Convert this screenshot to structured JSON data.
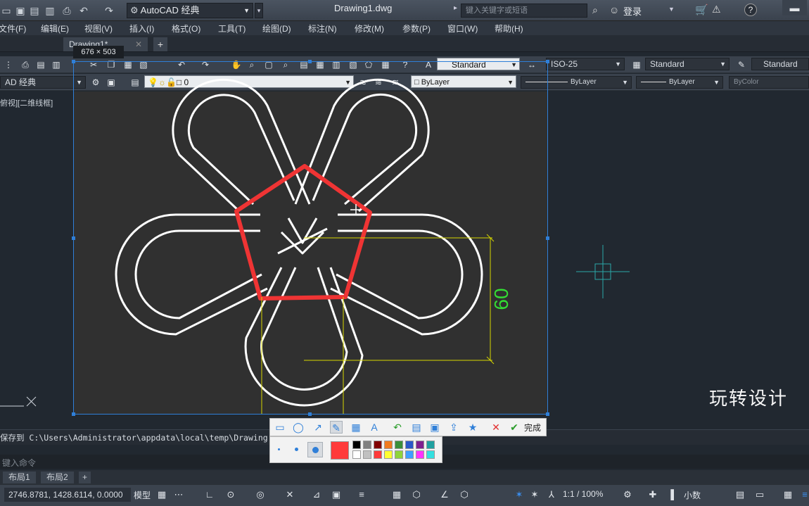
{
  "titlebar": {
    "workspace": "AutoCAD 经典",
    "title": "Drawing1.dwg",
    "search_placeholder": "键入关键字或短语",
    "login": "登录",
    "help": "?"
  },
  "menu": [
    "文件(F)",
    "编辑(E)",
    "视图(V)",
    "插入(I)",
    "格式(O)",
    "工具(T)",
    "绘图(D)",
    "标注(N)",
    "修改(M)",
    "参数(P)",
    "窗口(W)",
    "帮助(H)"
  ],
  "doc_tab": "Drawing1*",
  "capture": {
    "size": "676 × 503"
  },
  "toolbar": {
    "text_style": "Standard",
    "dim_style": "ISO-25",
    "table_style": "Standard",
    "multileader_style": "Standard",
    "workspace_short": "AD 经典",
    "layer": "0",
    "color": "ByLayer",
    "linetype": "ByLayer",
    "lineweight": "ByLayer",
    "plotstyle": "ByColor"
  },
  "viewport_label": "俯视][二维线框]",
  "dimension": {
    "value": "60"
  },
  "shot_tool": {
    "done": "完成"
  },
  "palette": {
    "current": "#ff3b3b",
    "row1": [
      "#000000",
      "#808080",
      "#800000",
      "#f07b1e",
      "#3a8f3a",
      "#2a58c8",
      "#7f1f8f",
      "#1fa0a0"
    ],
    "row2": [
      "#ffffff",
      "#c0c0c0",
      "#ff3b3b",
      "#ffff33",
      "#8fd43a",
      "#3f9fff",
      "#ff33ff",
      "#33e0e0"
    ]
  },
  "command": {
    "history": "保存到  C:\\Users\\Administrator\\appdata\\local\\temp\\Drawing",
    "placeholder": "键入命令"
  },
  "layouts": [
    "布局1",
    "布局2"
  ],
  "status": {
    "coords": "2746.8781, 1428.6114, 0.0000",
    "model": "模型",
    "scale": "1:1 / 100%",
    "units": "小数"
  },
  "watermark": "玩转设计"
}
